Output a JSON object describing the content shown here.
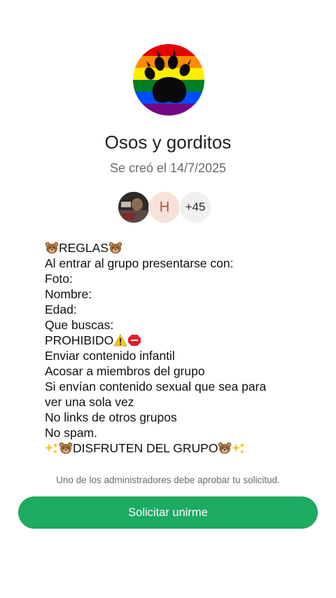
{
  "group": {
    "name": "Osos y gorditos",
    "created": "Se creó el 14/7/2025",
    "avatar_icon": "rainbow-paw-icon"
  },
  "members": {
    "initial": "H",
    "more_count": "+45"
  },
  "description": {
    "title": "REGLAS",
    "line1": "Al entrar al grupo presentarse con:",
    "line2": "Foto:",
    "line3": "Nombre:",
    "line4": "Edad:",
    "line5": "Que buscas:",
    "prohibido": "PROHIBIDO",
    "line6": "Enviar contenido infantil",
    "line7": "Acosar a miembros del grupo",
    "line8": "Si envían contenido sexual que sea para",
    "line9": "ver una sola vez",
    "line10": "No links de otros grupos",
    "line11": "No spam.",
    "closing": "DISFRUTEN DEL GRUPO"
  },
  "approval_note": "Uno de los administradores debe aprobar tu solicitud.",
  "join_button": "Solicitar unirme",
  "colors": {
    "accent": "#1daa61",
    "rainbow": [
      "#e40303",
      "#ff8c00",
      "#ffed00",
      "#008026",
      "#004dff",
      "#750787"
    ]
  }
}
